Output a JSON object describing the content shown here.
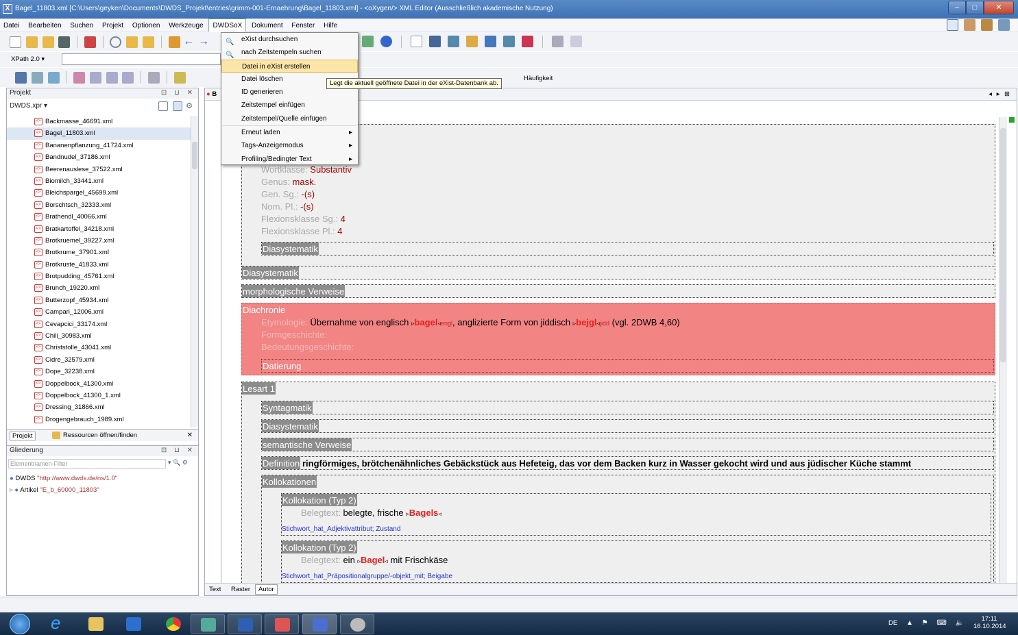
{
  "window": {
    "title": "Bagel_11803.xml [C:\\Users\\geyken\\Documents\\DWDS_Projekt\\entries\\grimm-001-Ernaehrung\\Bagel_11803.xml] - <oXygen/> XML Editor (Ausschließlich akademische Nutzung)",
    "min": "–",
    "max": "□",
    "close": "✕"
  },
  "menu": [
    "Datei",
    "Bearbeiten",
    "Suchen",
    "Projekt",
    "Optionen",
    "Werkzeuge",
    "DWDSoX",
    "Dokument",
    "Fenster",
    "Hilfe"
  ],
  "xpath": {
    "label": "XPath 2.0 ▾"
  },
  "toolbar3_text": "Häufigkeit",
  "project": {
    "title": "Projekt",
    "controls": "⊡ ⊔ ✕",
    "file": "DWDS.xpr ▾",
    "files": [
      "Backmasse_46691.xml",
      "Bagel_11803.xml",
      "Bananenpflanzung_41724.xml",
      "Bandnudel_37186.xml",
      "Beerenauslese_37522.xml",
      "Biomilch_33441.xml",
      "Bleichspargel_45699.xml",
      "Borschtsch_32333.xml",
      "Brathendl_40066.xml",
      "Bratkartoffel_34218.xml",
      "Brotkruemel_39227.xml",
      "Brotkrume_37901.xml",
      "Brotkruste_41833.xml",
      "Brotpudding_45761.xml",
      "Brunch_19220.xml",
      "Butterzopf_45934.xml",
      "Campari_12006.xml",
      "Cevapcici_33174.xml",
      "Chili_30983.xml",
      "Christstolle_43041.xml",
      "Cidre_32579.xml",
      "Dope_32238.xml",
      "Doppelbock_41300.xml",
      "Doppelbock_41300_1.xml",
      "Dressing_31866.xml",
      "Drogengebrauch_1989.xml"
    ],
    "tabs": [
      "Projekt",
      "Ressourcen öffnen/finden"
    ],
    "tabs_close": "✕"
  },
  "outline": {
    "title": "Gliederung",
    "controls": "⊡ ⊔ ✕",
    "filter_placeholder": "Elementnamen-Filter",
    "filter_btns": "▾ 🔍 ⚙",
    "nodes": [
      {
        "name": "DWDS",
        "attr": "\"http://www.dwds.de/ns/1.0\""
      },
      {
        "name": "Artikel",
        "attr": "\"E_b_60000_11803\""
      }
    ]
  },
  "editor": {
    "tab": "B",
    "tab_nav": "◂ ▸ ⊞",
    "grammar": {
      "wortklasse_label": "Wortklasse:",
      "wortklasse": "Substantiv",
      "genus_label": "Genus:",
      "genus": "mask.",
      "gensg_label": "Gen. Sg.:",
      "gensg": "-(s)",
      "nompl_label": "Nom. Pl.:",
      "nompl": "-(s)",
      "fksg_label": "Flexionsklasse Sg.:",
      "fksg": "4",
      "fkpl_label": "Flexionsklasse Pl.:",
      "fkpl": "4",
      "diasys": "Diasystematik"
    },
    "diasys": "Diasystematik",
    "morph": "morphologische Verweise",
    "diachronie": {
      "tag": "Diachronie",
      "etym_label": "Etymologie:",
      "etym_pre": "Übernahme von englisch",
      "w1": "bagel",
      "w1_lang": "engl",
      "etym_mid": ", anglizierte Form von jiddisch",
      "w2": "bejgl",
      "w2_lang": "jidd",
      "etym_post": "(vgl. 2DWB 4,60)",
      "formg": "Formgeschichte:",
      "bedg": "Bedeutungsgeschichte:",
      "datierung": "Datierung"
    },
    "lesart": {
      "tag": "Lesart 1",
      "syntag": "Syntagmatik",
      "diasys": "Diasystematik",
      "sem": "semantische Verweise",
      "def_tag": "Definition",
      "def": "ringförmiges, brötchenähnliches Gebäckstück aus Hefeteig, das vor dem Backen kurz in Wasser gekocht wird und aus jüdischer Küche stammt",
      "koll": "Kollokationen",
      "k1": {
        "tag": "Kollokation (Typ 2)",
        "beleg_label": "Belegtext:",
        "pre": "belegte, frische",
        "w": "Bagels",
        "link": "Stichwort_hat_Adjektivattribut; Zustand"
      },
      "k2": {
        "tag": "Kollokation (Typ 2)",
        "beleg_label": "Belegtext:",
        "pre": "ein",
        "w": "Bagel",
        "post": "mit Frischkäse",
        "link": "Stichwort_hat_Präpositionalgruppe/-objekt_mit; Beigabe"
      }
    }
  },
  "modes": [
    "Text",
    "Raster",
    "Autor"
  ],
  "dwdsox_menu": [
    {
      "label": "eXist durchsuchen",
      "icon": "search-icon"
    },
    {
      "label": "nach Zeitstempeln suchen",
      "icon": "search-icon"
    },
    {
      "label": "Datei in eXist erstellen",
      "hl": true
    },
    {
      "label": "Datei löschen"
    },
    {
      "label": "ID generieren"
    },
    {
      "label": "Zeitstempel einfügen"
    },
    {
      "label": "Zeitstempel/Quelle einfügen"
    },
    {
      "label": "Erneut laden",
      "sub": true
    },
    {
      "label": "Tags-Anzeigemodus",
      "sub": true
    },
    {
      "label": "Profiling/Bedingter Text",
      "sub": true
    }
  ],
  "tooltip": "Legt die aktuell geöffnete Datei in der eXist-Datenbank ab.",
  "tray": {
    "lang": "DE",
    "time": "17:11",
    "date": "16.10.2014",
    "icons": "▲ ⚑ ⌨ 🔈"
  }
}
